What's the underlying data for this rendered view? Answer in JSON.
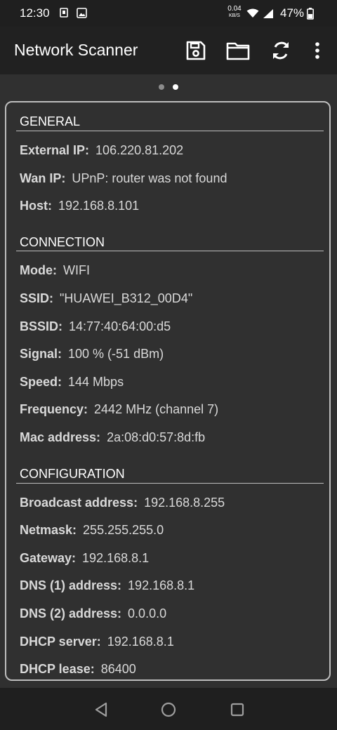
{
  "status_bar": {
    "time": "12:30",
    "net_speed_value": "0.04",
    "net_speed_unit": "KB/S",
    "battery": "47%",
    "icons": [
      "sim-icon",
      "image-icon",
      "wifi-icon",
      "signal-icon",
      "battery-icon"
    ]
  },
  "app_bar": {
    "title": "Network Scanner",
    "actions": [
      "save-icon",
      "folder-icon",
      "refresh-icon",
      "more-vert-icon"
    ]
  },
  "pager": {
    "count": 2,
    "active_index": 1
  },
  "sections": [
    {
      "title": "GENERAL",
      "rows": [
        {
          "label": "External IP:",
          "value": "106.220.81.202"
        },
        {
          "label": "Wan IP:",
          "value": "UPnP: router was not found"
        },
        {
          "label": "Host:",
          "value": "192.168.8.101"
        }
      ]
    },
    {
      "title": "CONNECTION",
      "rows": [
        {
          "label": "Mode:",
          "value": "WIFI"
        },
        {
          "label": "SSID:",
          "value": "\"HUAWEI_B312_00D4\""
        },
        {
          "label": "BSSID:",
          "value": "14:77:40:64:00:d5"
        },
        {
          "label": "Signal:",
          "value": "100 % (-51 dBm)"
        },
        {
          "label": "Speed:",
          "value": "144 Mbps"
        },
        {
          "label": "Frequency:",
          "value": "2442 MHz (channel 7)"
        },
        {
          "label": "Mac address:",
          "value": "2a:08:d0:57:8d:fb"
        }
      ]
    },
    {
      "title": "CONFIGURATION",
      "rows": [
        {
          "label": "Broadcast address:",
          "value": "192.168.8.255"
        },
        {
          "label": "Netmask:",
          "value": "255.255.255.0"
        },
        {
          "label": "Gateway:",
          "value": "192.168.8.1"
        },
        {
          "label": "DNS (1) address:",
          "value": "192.168.8.1"
        },
        {
          "label": "DNS (2) address:",
          "value": "0.0.0.0"
        },
        {
          "label": "DHCP server:",
          "value": "192.168.8.1"
        },
        {
          "label": "DHCP lease:",
          "value": "86400"
        }
      ]
    }
  ],
  "nav_bar": {
    "buttons": [
      "back-icon",
      "home-icon",
      "recents-icon"
    ]
  },
  "colors": {
    "background": "#303030",
    "appbar": "#212121",
    "statusbar": "#1f1f1f",
    "text": "#d9d9d9"
  }
}
